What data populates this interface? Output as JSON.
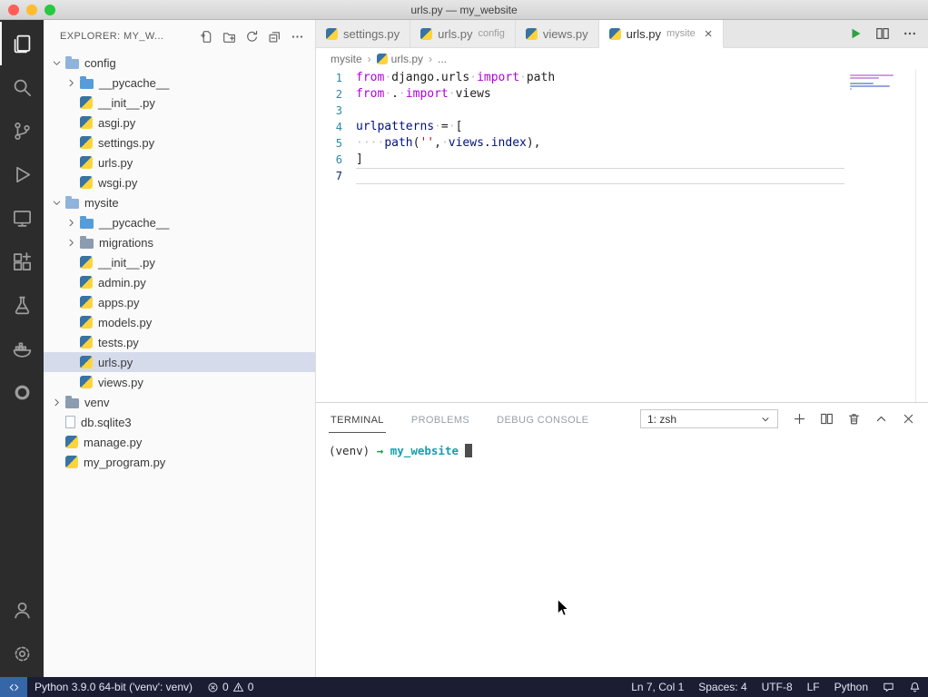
{
  "window": {
    "title": "urls.py — my_website"
  },
  "activity_bar": {
    "top": [
      {
        "name": "explorer",
        "icon": "files",
        "active": true
      },
      {
        "name": "search",
        "icon": "search",
        "active": false
      },
      {
        "name": "source-control",
        "icon": "git",
        "active": false
      },
      {
        "name": "run-debug",
        "icon": "debug",
        "active": false
      },
      {
        "name": "remote-explorer",
        "icon": "remote",
        "active": false
      },
      {
        "name": "extensions",
        "icon": "extensions",
        "active": false
      },
      {
        "name": "testing",
        "icon": "beaker",
        "active": false
      },
      {
        "name": "docker",
        "icon": "docker",
        "active": false
      },
      {
        "name": "extension-ring",
        "icon": "ring",
        "active": false
      }
    ],
    "bottom": [
      {
        "name": "account",
        "icon": "account"
      },
      {
        "name": "manage",
        "icon": "gear"
      }
    ]
  },
  "sidebar": {
    "header": {
      "title": "EXPLORER: MY_W...",
      "actions": [
        {
          "name": "new-file"
        },
        {
          "name": "new-folder"
        },
        {
          "name": "refresh"
        },
        {
          "name": "collapse-all"
        },
        {
          "name": "more-actions"
        }
      ]
    },
    "tree": [
      {
        "label": "config",
        "type": "folder-open",
        "level": 0,
        "chevron": "down"
      },
      {
        "label": "__pycache__",
        "type": "folder-blue",
        "level": 1,
        "chevron": "right"
      },
      {
        "label": "__init__.py",
        "type": "python",
        "level": 1
      },
      {
        "label": "asgi.py",
        "type": "python",
        "level": 1
      },
      {
        "label": "settings.py",
        "type": "python",
        "level": 1
      },
      {
        "label": "urls.py",
        "type": "python",
        "level": 1
      },
      {
        "label": "wsgi.py",
        "type": "python",
        "level": 1
      },
      {
        "label": "mysite",
        "type": "folder-open",
        "level": 0,
        "chevron": "down"
      },
      {
        "label": "__pycache__",
        "type": "folder-blue",
        "level": 1,
        "chevron": "right"
      },
      {
        "label": "migrations",
        "type": "folder-gray",
        "level": 1,
        "chevron": "right"
      },
      {
        "label": "__init__.py",
        "type": "python",
        "level": 1
      },
      {
        "label": "admin.py",
        "type": "python",
        "level": 1
      },
      {
        "label": "apps.py",
        "type": "python",
        "level": 1
      },
      {
        "label": "models.py",
        "type": "python",
        "level": 1
      },
      {
        "label": "tests.py",
        "type": "python",
        "level": 1
      },
      {
        "label": "urls.py",
        "type": "python",
        "level": 1,
        "selected": true
      },
      {
        "label": "views.py",
        "type": "python",
        "level": 1
      },
      {
        "label": "venv",
        "type": "folder-gray",
        "level": 0,
        "chevron": "right"
      },
      {
        "label": "db.sqlite3",
        "type": "file",
        "level": 0
      },
      {
        "label": "manage.py",
        "type": "python",
        "level": 0
      },
      {
        "label": "my_program.py",
        "type": "python",
        "level": 0
      }
    ]
  },
  "editor": {
    "tabs": [
      {
        "label": "settings.py",
        "hint": "",
        "active": false,
        "close": false
      },
      {
        "label": "urls.py",
        "hint": "config",
        "active": false,
        "close": false
      },
      {
        "label": "views.py",
        "hint": "",
        "active": false,
        "close": false
      },
      {
        "label": "urls.py",
        "hint": "mysite",
        "active": true,
        "close": true
      }
    ],
    "actions": [
      {
        "name": "run-python-file",
        "icon": "play"
      },
      {
        "name": "split-editor",
        "icon": "split"
      },
      {
        "name": "more-editor-actions",
        "icon": "ellipsis"
      }
    ],
    "breadcrumb": [
      {
        "label": "mysite",
        "icon": null
      },
      {
        "label": "urls.py",
        "icon": "python"
      },
      {
        "label": "...",
        "icon": null
      }
    ],
    "code": {
      "current_line": 7,
      "lines": [
        {
          "num": 1,
          "tokens": [
            [
              "kw",
              "from"
            ],
            [
              "ws",
              "·"
            ],
            [
              "pl",
              "django.urls"
            ],
            [
              "ws",
              "·"
            ],
            [
              "kw",
              "import"
            ],
            [
              "ws",
              "·"
            ],
            [
              "pl",
              "path"
            ]
          ]
        },
        {
          "num": 2,
          "tokens": [
            [
              "kw",
              "from"
            ],
            [
              "ws",
              "·"
            ],
            [
              "pl",
              "."
            ],
            [
              "ws",
              "·"
            ],
            [
              "kw",
              "import"
            ],
            [
              "ws",
              "·"
            ],
            [
              "pl",
              "views"
            ]
          ]
        },
        {
          "num": 3,
          "tokens": []
        },
        {
          "num": 4,
          "tokens": [
            [
              "vr",
              "urlpatterns"
            ],
            [
              "ws",
              "·"
            ],
            [
              "pl",
              "="
            ],
            [
              "ws",
              "·"
            ],
            [
              "pl",
              "["
            ]
          ]
        },
        {
          "num": 5,
          "tokens": [
            [
              "ws",
              "····"
            ],
            [
              "vr",
              "path"
            ],
            [
              "pl",
              "("
            ],
            [
              "st",
              "''"
            ],
            [
              "pl",
              ","
            ],
            [
              "ws",
              "·"
            ],
            [
              "vr",
              "views.index"
            ],
            [
              "pl",
              "),"
            ]
          ]
        },
        {
          "num": 6,
          "tokens": [
            [
              "pl",
              "]"
            ]
          ]
        },
        {
          "num": 7,
          "tokens": []
        }
      ]
    }
  },
  "panel": {
    "tabs": [
      {
        "label": "TERMINAL",
        "active": true
      },
      {
        "label": "PROBLEMS",
        "active": false
      },
      {
        "label": "DEBUG CONSOLE",
        "active": false
      }
    ],
    "shell_select": "1: zsh",
    "actions": [
      {
        "name": "new-terminal",
        "icon": "plus"
      },
      {
        "name": "split-terminal",
        "icon": "split"
      },
      {
        "name": "kill-terminal",
        "icon": "trash"
      },
      {
        "name": "maximize-panel",
        "icon": "chevron-up"
      },
      {
        "name": "close-panel",
        "icon": "close"
      }
    ]
  },
  "terminal": {
    "line": [
      [
        "prompt",
        "(venv)"
      ],
      [
        "sp",
        " "
      ],
      [
        "arrow",
        "→"
      ],
      [
        "sp",
        " "
      ],
      [
        "dir",
        "my_website"
      ]
    ]
  },
  "status_bar": {
    "left": {
      "interpreter": "Python 3.9.0 64-bit ('venv': venv)",
      "errors": "0",
      "warnings": "0"
    },
    "right": [
      {
        "name": "cursor-position",
        "label": "Ln 7, Col 1"
      },
      {
        "name": "indentation",
        "label": "Spaces: 4"
      },
      {
        "name": "encoding",
        "label": "UTF-8"
      },
      {
        "name": "eol",
        "label": "LF"
      },
      {
        "name": "language-mode",
        "label": "Python"
      },
      {
        "name": "feedback",
        "icon": "feedback"
      },
      {
        "name": "notifications",
        "icon": "bell"
      }
    ]
  },
  "colors": {
    "status_bar_bg": "#1b1d33",
    "remote_indicator_bg": "#3566a8",
    "keyword": "#af00db",
    "string": "#a31515",
    "identifier": "#001080",
    "whitespace_dot": "#bcc3cd",
    "run_button_green": "#2ea043",
    "terminal_directory": "#12a0b0",
    "terminal_arrow_green": "#1f9e44",
    "selection_row": "#d6dbec",
    "python_icon_blue": "#3873a3",
    "python_icon_yellow": "#ffd43b",
    "traffic_red": "#ff5f57",
    "traffic_yellow": "#febc2e",
    "traffic_green": "#28c840"
  }
}
